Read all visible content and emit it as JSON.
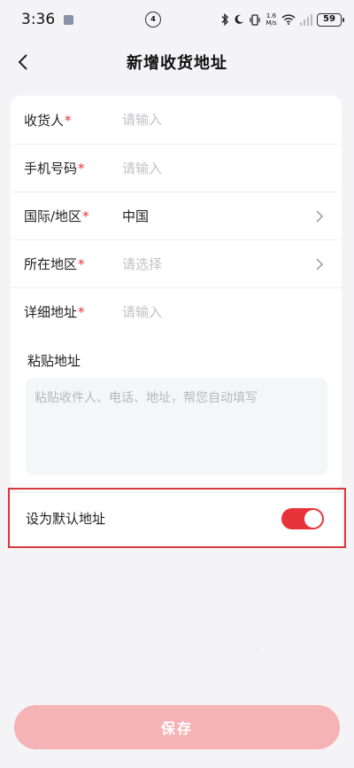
{
  "status_bar": {
    "time": "3:36",
    "center_icon_text": "4",
    "speed_value": "1.6",
    "speed_unit": "M/s",
    "battery": "59"
  },
  "header": {
    "title": "新增收货地址"
  },
  "form": {
    "recipient": {
      "label": "收货人",
      "required_mark": "*",
      "placeholder": "请输入",
      "value": ""
    },
    "phone": {
      "label": "手机号码",
      "required_mark": "*",
      "placeholder": "请输入",
      "value": ""
    },
    "country": {
      "label": "国际/地区",
      "required_mark": "*",
      "value": "中国"
    },
    "region": {
      "label": "所在地区",
      "required_mark": "*",
      "value": "请选择"
    },
    "detail": {
      "label": "详细地址",
      "required_mark": "*",
      "placeholder": "请输入",
      "value": ""
    },
    "paste": {
      "label": "粘贴地址",
      "placeholder": "粘贴收件人、电话、地址，帮您自动填写",
      "value": ""
    }
  },
  "default_address": {
    "label": "设为默认地址",
    "enabled": true
  },
  "save_button": {
    "label": "保存"
  },
  "colors": {
    "accent": "#e8333b",
    "save_disabled": "#f5b3b6",
    "highlight_border": "#d9383f",
    "page_background": "#f4f4f6"
  },
  "icons": [
    "back-chevron-icon",
    "chevron-right-icon",
    "bluetooth-icon",
    "moon-icon",
    "vibrate-icon",
    "wifi-icon",
    "signal-icon",
    "battery-icon",
    "nfc-icon"
  ]
}
